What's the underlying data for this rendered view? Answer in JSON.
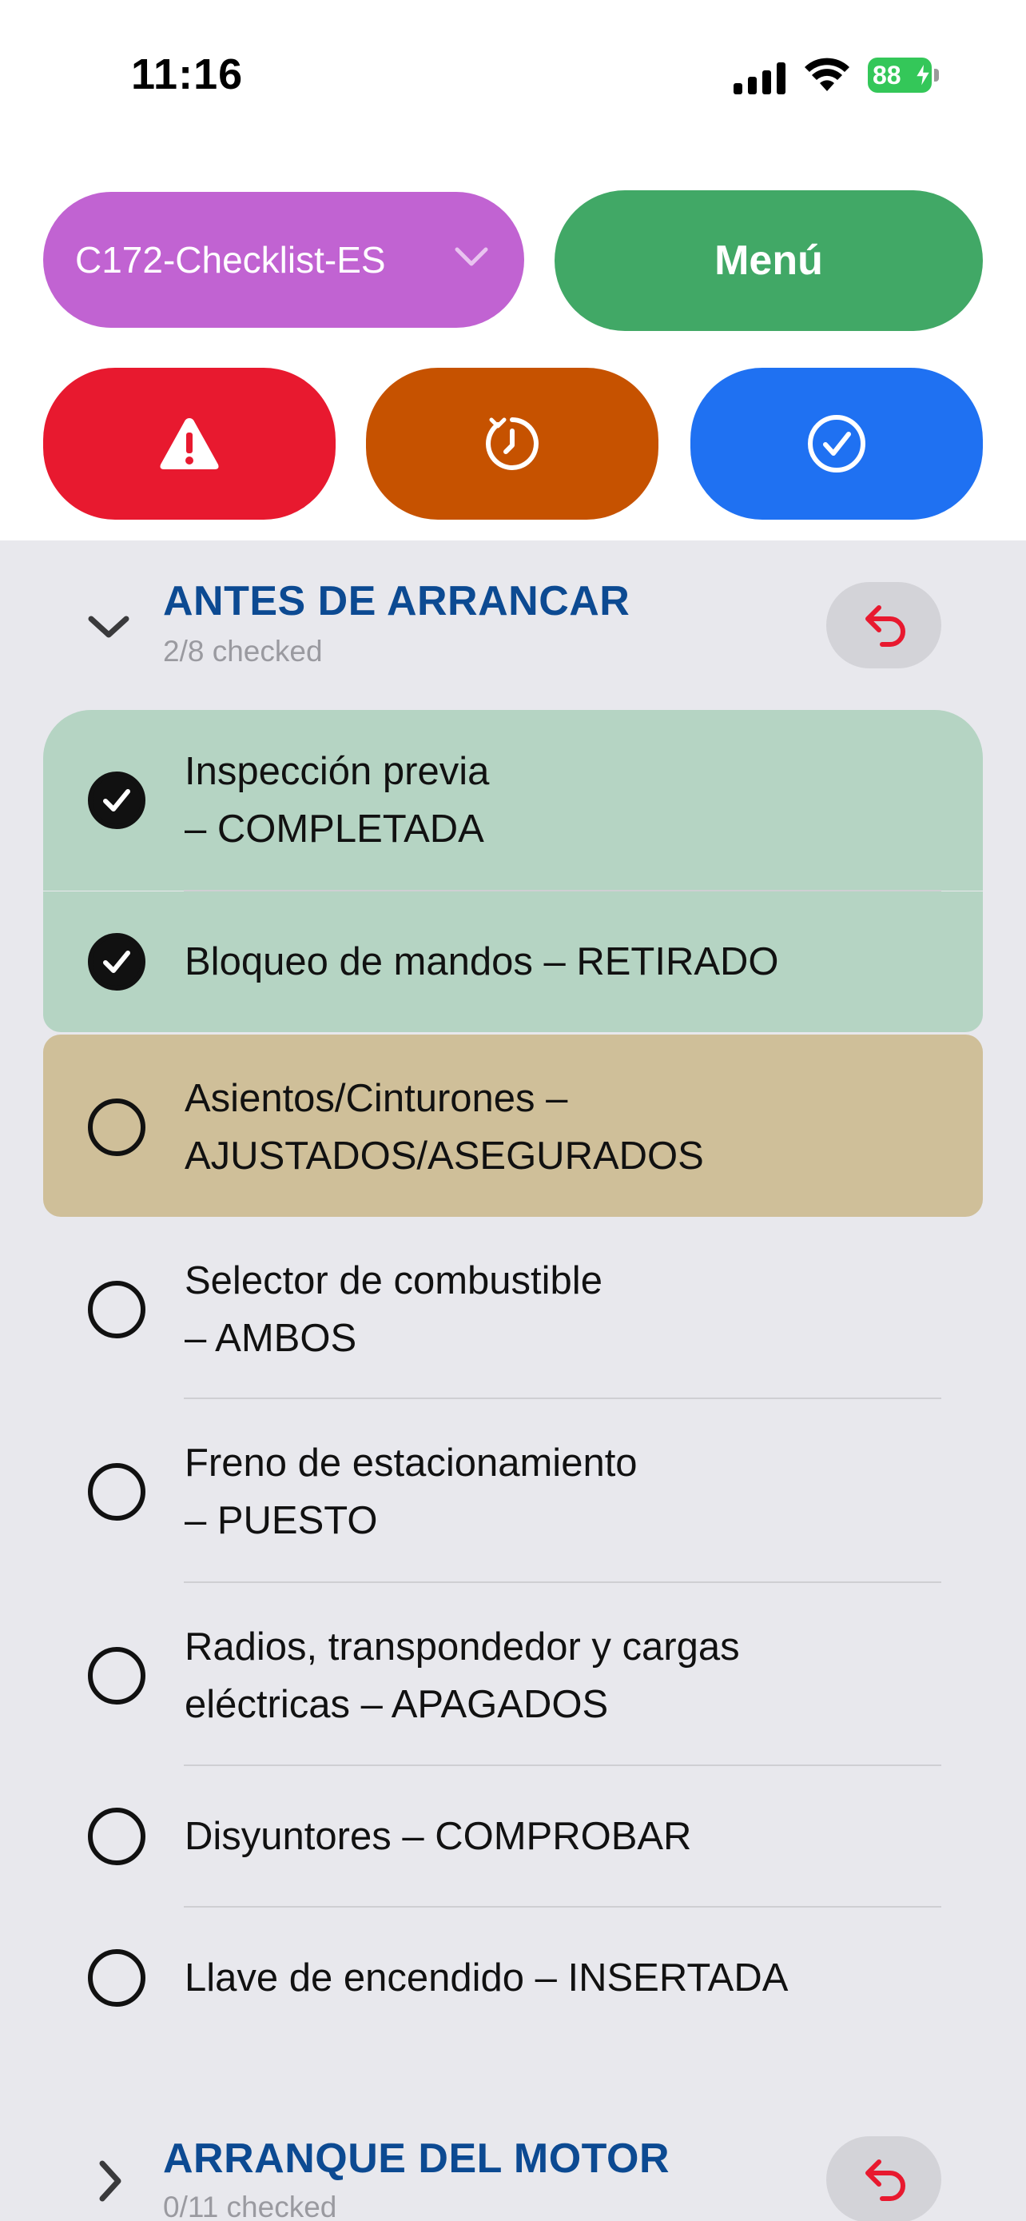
{
  "status_bar": {
    "time": "11:16",
    "battery": "88"
  },
  "toolbar": {
    "checklist_name": "C172-Checklist-ES",
    "menu_label": "Menú",
    "emergency_icon": "warning-triangle-icon",
    "reset_icon": "reset-clock-icon",
    "done_icon": "checkmark-circle-icon"
  },
  "colors": {
    "checklist_select": "#c163d2",
    "menu": "#41a866",
    "emergency": "#e8192f",
    "reset": "#c65200",
    "done": "#1f71f2",
    "checked_item": "#b5d4c3",
    "current_item": "#cfbf99",
    "section_title": "#0c4a92"
  },
  "sections": [
    {
      "title": "ANTES DE ARRANCAR",
      "count": "2/8 checked",
      "expanded": true,
      "items": [
        {
          "line1": "Inspección previa",
          "line2": "– COMPLETADA",
          "checked": true
        },
        {
          "line1": "Bloqueo de mandos – RETIRADO",
          "line2": "",
          "checked": true
        },
        {
          "line1": "Asientos/Cinturones –",
          "line2": "AJUSTADOS/ASEGURADOS",
          "checked": false,
          "current": true
        },
        {
          "line1": "Selector de combustible",
          "line2": "– AMBOS",
          "checked": false
        },
        {
          "line1": "Freno de estacionamiento",
          "line2": "– PUESTO",
          "checked": false
        },
        {
          "line1": "Radios, transpondedor y cargas",
          "line2": "eléctricas – APAGADOS",
          "checked": false
        },
        {
          "line1": "Disyuntores – COMPROBAR",
          "line2": "",
          "checked": false
        },
        {
          "line1": "Llave de encendido – INSERTADA",
          "line2": "",
          "checked": false
        }
      ]
    },
    {
      "title": "ARRANQUE DEL MOTOR",
      "count": "0/11 checked",
      "expanded": false
    }
  ]
}
